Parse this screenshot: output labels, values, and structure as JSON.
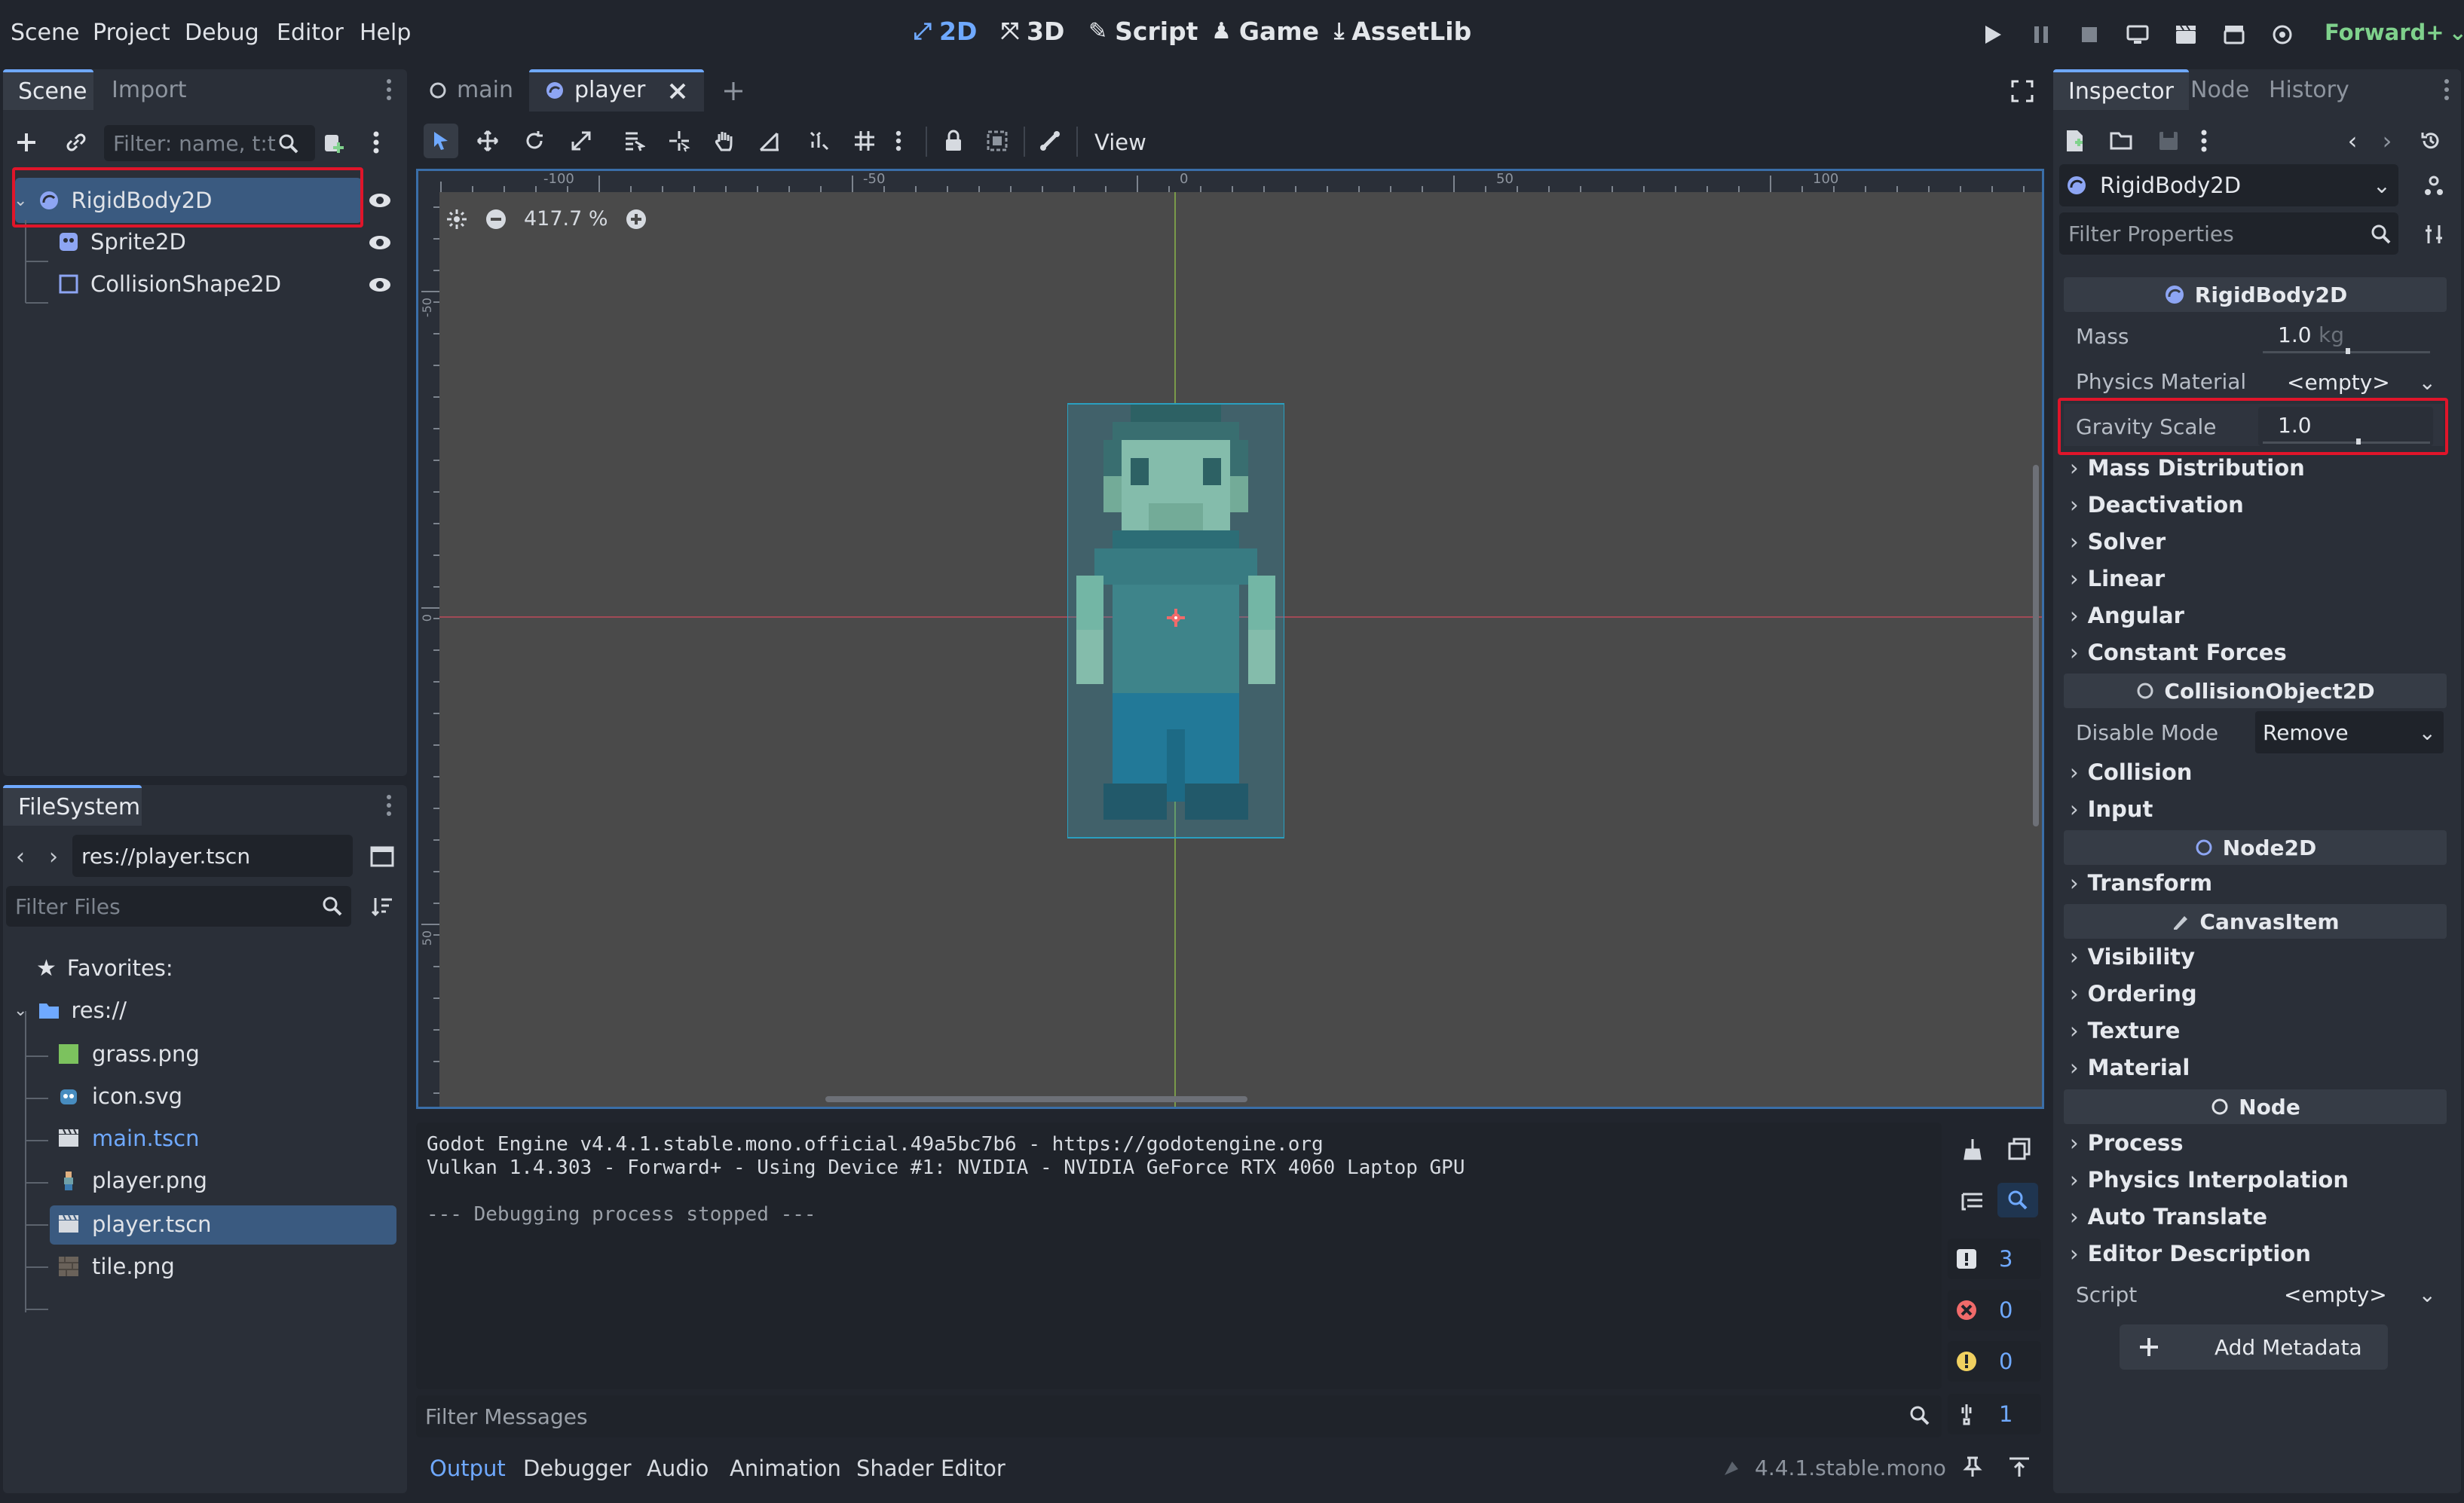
{
  "menu": [
    "Scene",
    "Project",
    "Debug",
    "Editor",
    "Help"
  ],
  "workspaces": [
    {
      "label": "2D",
      "icon": "2d-icon",
      "active": true
    },
    {
      "label": "3D",
      "icon": "3d-icon",
      "active": false
    },
    {
      "label": "Script",
      "icon": "script-icon",
      "active": false
    },
    {
      "label": "Game",
      "icon": "game-icon",
      "active": false
    },
    {
      "label": "AssetLib",
      "icon": "assetlib-icon",
      "active": false
    }
  ],
  "renderer": "Forward+",
  "scene_dock": {
    "tabs": [
      "Scene",
      "Import"
    ],
    "filter_placeholder": "Filter: name, t:t",
    "nodes": [
      {
        "name": "RigidBody2D",
        "icon": "rigidbody-icon",
        "selected": true
      },
      {
        "name": "Sprite2D",
        "icon": "sprite-icon"
      },
      {
        "name": "CollisionShape2D",
        "icon": "collisionshape-icon"
      }
    ]
  },
  "filesystem": {
    "tab": "FileSystem",
    "path": "res://player.tscn",
    "filter_placeholder": "Filter Files",
    "favorites_label": "Favorites:",
    "root": "res://",
    "files": [
      {
        "name": "grass.png",
        "icon": "image-icon"
      },
      {
        "name": "icon.svg",
        "icon": "godot-icon"
      },
      {
        "name": "main.tscn",
        "icon": "scene-icon",
        "highlight": true
      },
      {
        "name": "player.png",
        "icon": "image-icon"
      },
      {
        "name": "player.tscn",
        "icon": "scene-icon",
        "selected": true
      },
      {
        "name": "tile.png",
        "icon": "image-icon"
      }
    ]
  },
  "editor_tabs": [
    {
      "label": "main",
      "icon": "node-circle-icon",
      "active": false
    },
    {
      "label": "player",
      "icon": "rigidbody-icon",
      "active": true
    }
  ],
  "toolbar": {
    "view_label": "View"
  },
  "viewport": {
    "zoom": "417.7 %",
    "ruler_top": [
      "-100",
      "-50",
      "0",
      "50",
      "100"
    ],
    "ruler_left": [
      "-50",
      "0",
      "50"
    ]
  },
  "output": {
    "lines": [
      "Godot Engine v4.4.1.stable.mono.official.49a5bc7b6 - https://godotengine.org",
      "Vulkan 1.4.303 - Forward+ - Using Device #1: NVIDIA - NVIDIA GeForce RTX 4060 Laptop GPU",
      "",
      "--- Debugging process stopped ---"
    ],
    "filter_placeholder": "Filter Messages",
    "counts": {
      "messages": "3",
      "errors": "0",
      "warnings": "0",
      "editor": "1"
    }
  },
  "bottom_tabs": [
    "Output",
    "Debugger",
    "Audio",
    "Animation",
    "Shader Editor"
  ],
  "version": "4.4.1.stable.mono",
  "inspector": {
    "tabs": [
      "Inspector",
      "Node",
      "History"
    ],
    "object": "RigidBody2D",
    "filter_placeholder": "Filter Properties",
    "sections": {
      "rigidbody": "RigidBody2D",
      "collisionobject": "CollisionObject2D",
      "node2d": "Node2D",
      "canvasitem": "CanvasItem",
      "node": "Node"
    },
    "mass": {
      "label": "Mass",
      "value": "1.0",
      "unit": "kg"
    },
    "physics_material": {
      "label": "Physics Material",
      "value": "<empty>"
    },
    "gravity_scale": {
      "label": "Gravity Scale",
      "value": "1.0"
    },
    "rigid_groups": [
      "Mass Distribution",
      "Deactivation",
      "Solver",
      "Linear",
      "Angular",
      "Constant Forces"
    ],
    "disable_mode": {
      "label": "Disable Mode",
      "value": "Remove"
    },
    "collision_groups": [
      "Collision",
      "Input"
    ],
    "node2d_groups": [
      "Transform"
    ],
    "canvas_groups": [
      "Visibility",
      "Ordering",
      "Texture",
      "Material"
    ],
    "node_groups": [
      "Process",
      "Physics Interpolation",
      "Auto Translate",
      "Editor Description"
    ],
    "script": {
      "label": "Script",
      "value": "<empty>"
    },
    "add_metadata": "Add Metadata"
  }
}
